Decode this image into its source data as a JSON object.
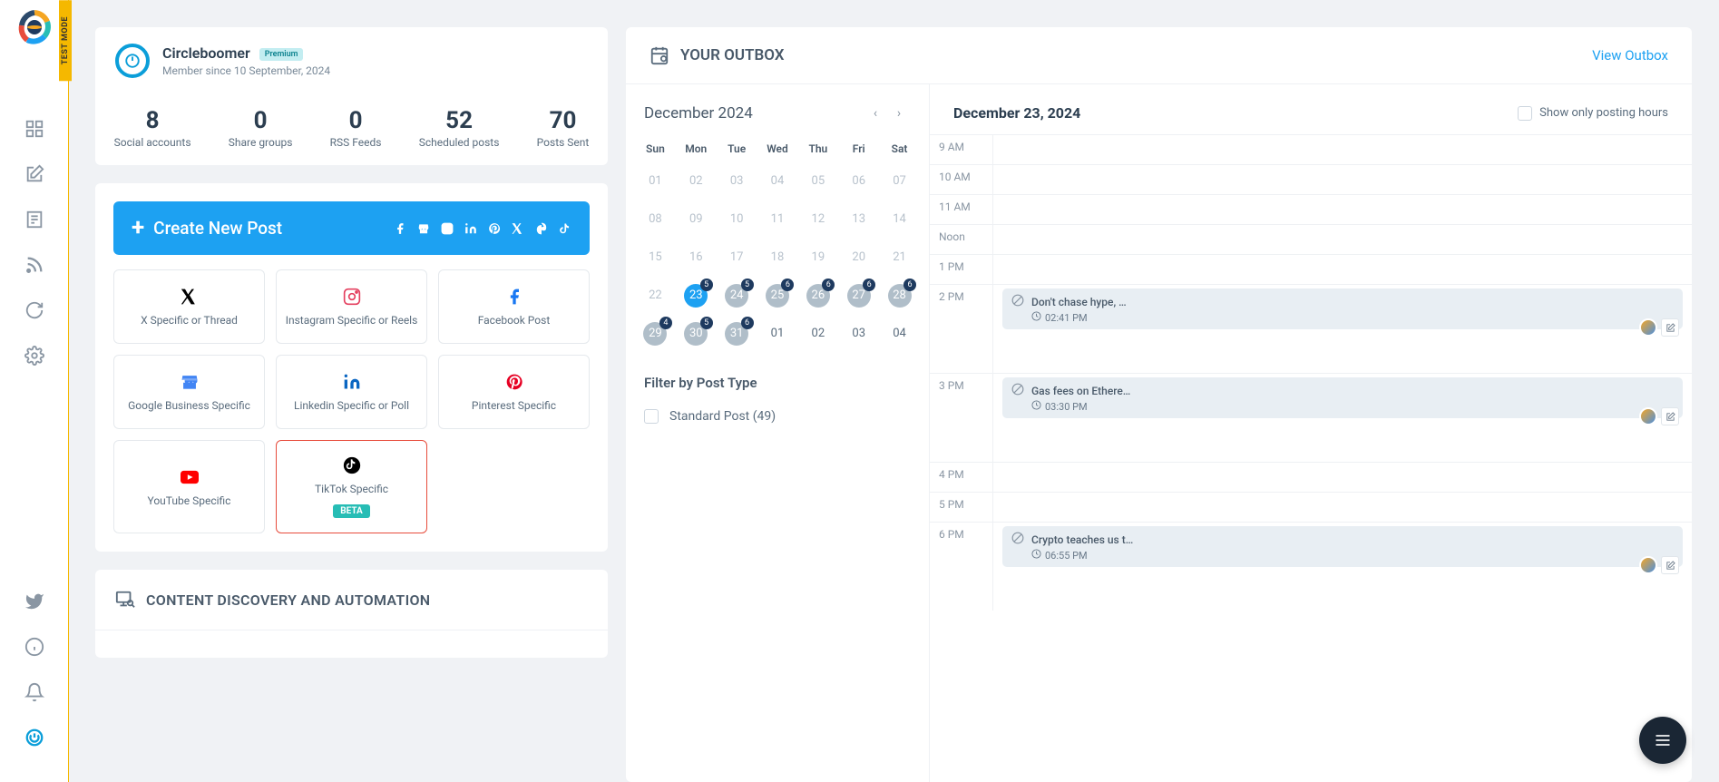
{
  "test_mode_label": "TEST MODE",
  "profile": {
    "name": "Circleboomer",
    "badge": "Premium",
    "member_since": "Member since 10 September, 2024"
  },
  "stats": [
    {
      "value": "8",
      "label": "Social accounts"
    },
    {
      "value": "0",
      "label": "Share groups"
    },
    {
      "value": "0",
      "label": "RSS Feeds"
    },
    {
      "value": "52",
      "label": "Scheduled posts"
    },
    {
      "value": "70",
      "label": "Posts Sent"
    }
  ],
  "create": {
    "button_label": "Create New Post",
    "platforms": [
      {
        "label": "X Specific or Thread"
      },
      {
        "label": "Instagram Specific or Reels"
      },
      {
        "label": "Facebook Post"
      },
      {
        "label": "Google Business Specific"
      },
      {
        "label": "Linkedin Specific or Poll"
      },
      {
        "label": "Pinterest Specific"
      },
      {
        "label": "YouTube Specific"
      },
      {
        "label": "TikTok Specific",
        "highlight": true,
        "beta": "BETA"
      }
    ]
  },
  "discovery_title": "CONTENT DISCOVERY AND AUTOMATION",
  "outbox": {
    "title": "YOUR OUTBOX",
    "view_link": "View Outbox",
    "month": "December 2024",
    "selected_date": "December 23, 2024",
    "show_only_label": "Show only posting hours",
    "dow": [
      "Sun",
      "Mon",
      "Tue",
      "Wed",
      "Thu",
      "Fri",
      "Sat"
    ],
    "weeks": [
      [
        {
          "d": "01"
        },
        {
          "d": "02"
        },
        {
          "d": "03"
        },
        {
          "d": "04"
        },
        {
          "d": "05"
        },
        {
          "d": "06"
        },
        {
          "d": "07"
        }
      ],
      [
        {
          "d": "08"
        },
        {
          "d": "09"
        },
        {
          "d": "10"
        },
        {
          "d": "11"
        },
        {
          "d": "12"
        },
        {
          "d": "13"
        },
        {
          "d": "14"
        }
      ],
      [
        {
          "d": "15"
        },
        {
          "d": "16"
        },
        {
          "d": "17"
        },
        {
          "d": "18"
        },
        {
          "d": "19"
        },
        {
          "d": "20"
        },
        {
          "d": "21"
        }
      ],
      [
        {
          "d": "22"
        },
        {
          "d": "23",
          "cls": "active",
          "badge": "5"
        },
        {
          "d": "24",
          "cls": "gray",
          "badge": "5"
        },
        {
          "d": "25",
          "cls": "gray",
          "badge": "6"
        },
        {
          "d": "26",
          "cls": "gray",
          "badge": "6"
        },
        {
          "d": "27",
          "cls": "gray",
          "badge": "6"
        },
        {
          "d": "28",
          "cls": "gray",
          "badge": "6"
        }
      ],
      [
        {
          "d": "29",
          "cls": "gray",
          "badge": "4"
        },
        {
          "d": "30",
          "cls": "gray",
          "badge": "5"
        },
        {
          "d": "31",
          "cls": "gray",
          "badge": "6"
        },
        {
          "d": "01",
          "cls": "plain"
        },
        {
          "d": "02",
          "cls": "plain"
        },
        {
          "d": "03",
          "cls": "plain"
        },
        {
          "d": "04",
          "cls": "plain"
        }
      ]
    ],
    "filter_title": "Filter by Post Type",
    "filter_option": "Standard Post (49)",
    "hours": [
      "9 AM",
      "10 AM",
      "11 AM",
      "Noon",
      "1 PM",
      "2 PM",
      "3 PM",
      "4 PM",
      "5 PM",
      "6 PM"
    ],
    "posts": {
      "2pm": {
        "title": "Don't chase hype, …",
        "time": "02:41 PM"
      },
      "3pm": {
        "title": "Gas fees on Ethere…",
        "time": "03:30 PM"
      },
      "6pm": {
        "title": "Crypto teaches us t…",
        "time": "06:55 PM"
      }
    }
  }
}
